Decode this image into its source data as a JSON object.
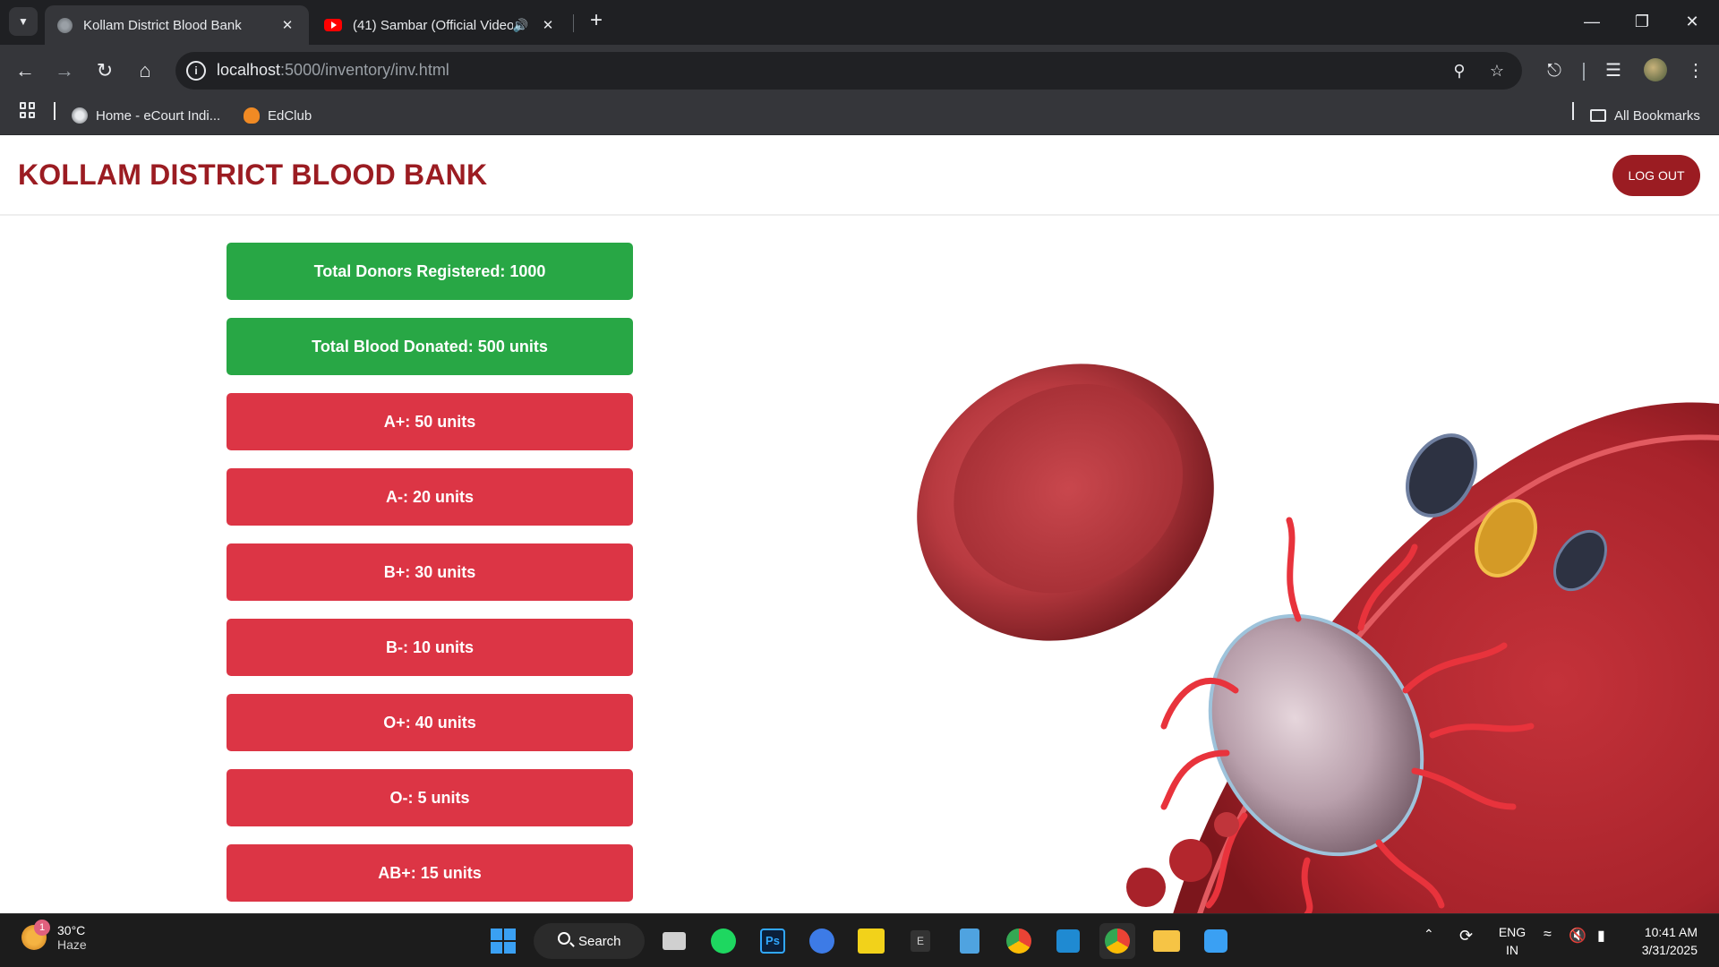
{
  "browser": {
    "tabs": [
      {
        "title": "Kollam District Blood Bank",
        "active": true
      },
      {
        "title": "(41) Sambar (Official Video)",
        "active": false
      }
    ],
    "url_host": "localhost",
    "url_path": ":5000/inventory/inv.html",
    "bookmarks": [
      {
        "label": "Home - eCourt Indi..."
      },
      {
        "label": "EdClub"
      }
    ],
    "all_bookmarks_label": "All Bookmarks"
  },
  "site": {
    "title": "KOLLAM DISTRICT BLOOD BANK",
    "logout_label": "LOG OUT",
    "colors": {
      "brand": "#9b1c22",
      "total": "#28a745",
      "blood": "#dc3545"
    }
  },
  "inventory": {
    "totals": [
      {
        "label": "Total Donors Registered: 1000"
      },
      {
        "label": "Total Blood Donated: 500 units"
      }
    ],
    "blood_groups": [
      {
        "label": "A+: 50 units"
      },
      {
        "label": "A-: 20 units"
      },
      {
        "label": "B+: 30 units"
      },
      {
        "label": "B-: 10 units"
      },
      {
        "label": "O+: 40 units"
      },
      {
        "label": "O-: 5 units"
      },
      {
        "label": "AB+: 15 units"
      }
    ]
  },
  "taskbar": {
    "weather_temp": "30°C",
    "weather_cond": "Haze",
    "weather_badge": "1",
    "search_label": "Search",
    "lang_top": "ENG",
    "lang_bottom": "IN",
    "time": "10:41 AM",
    "date": "3/31/2025"
  }
}
